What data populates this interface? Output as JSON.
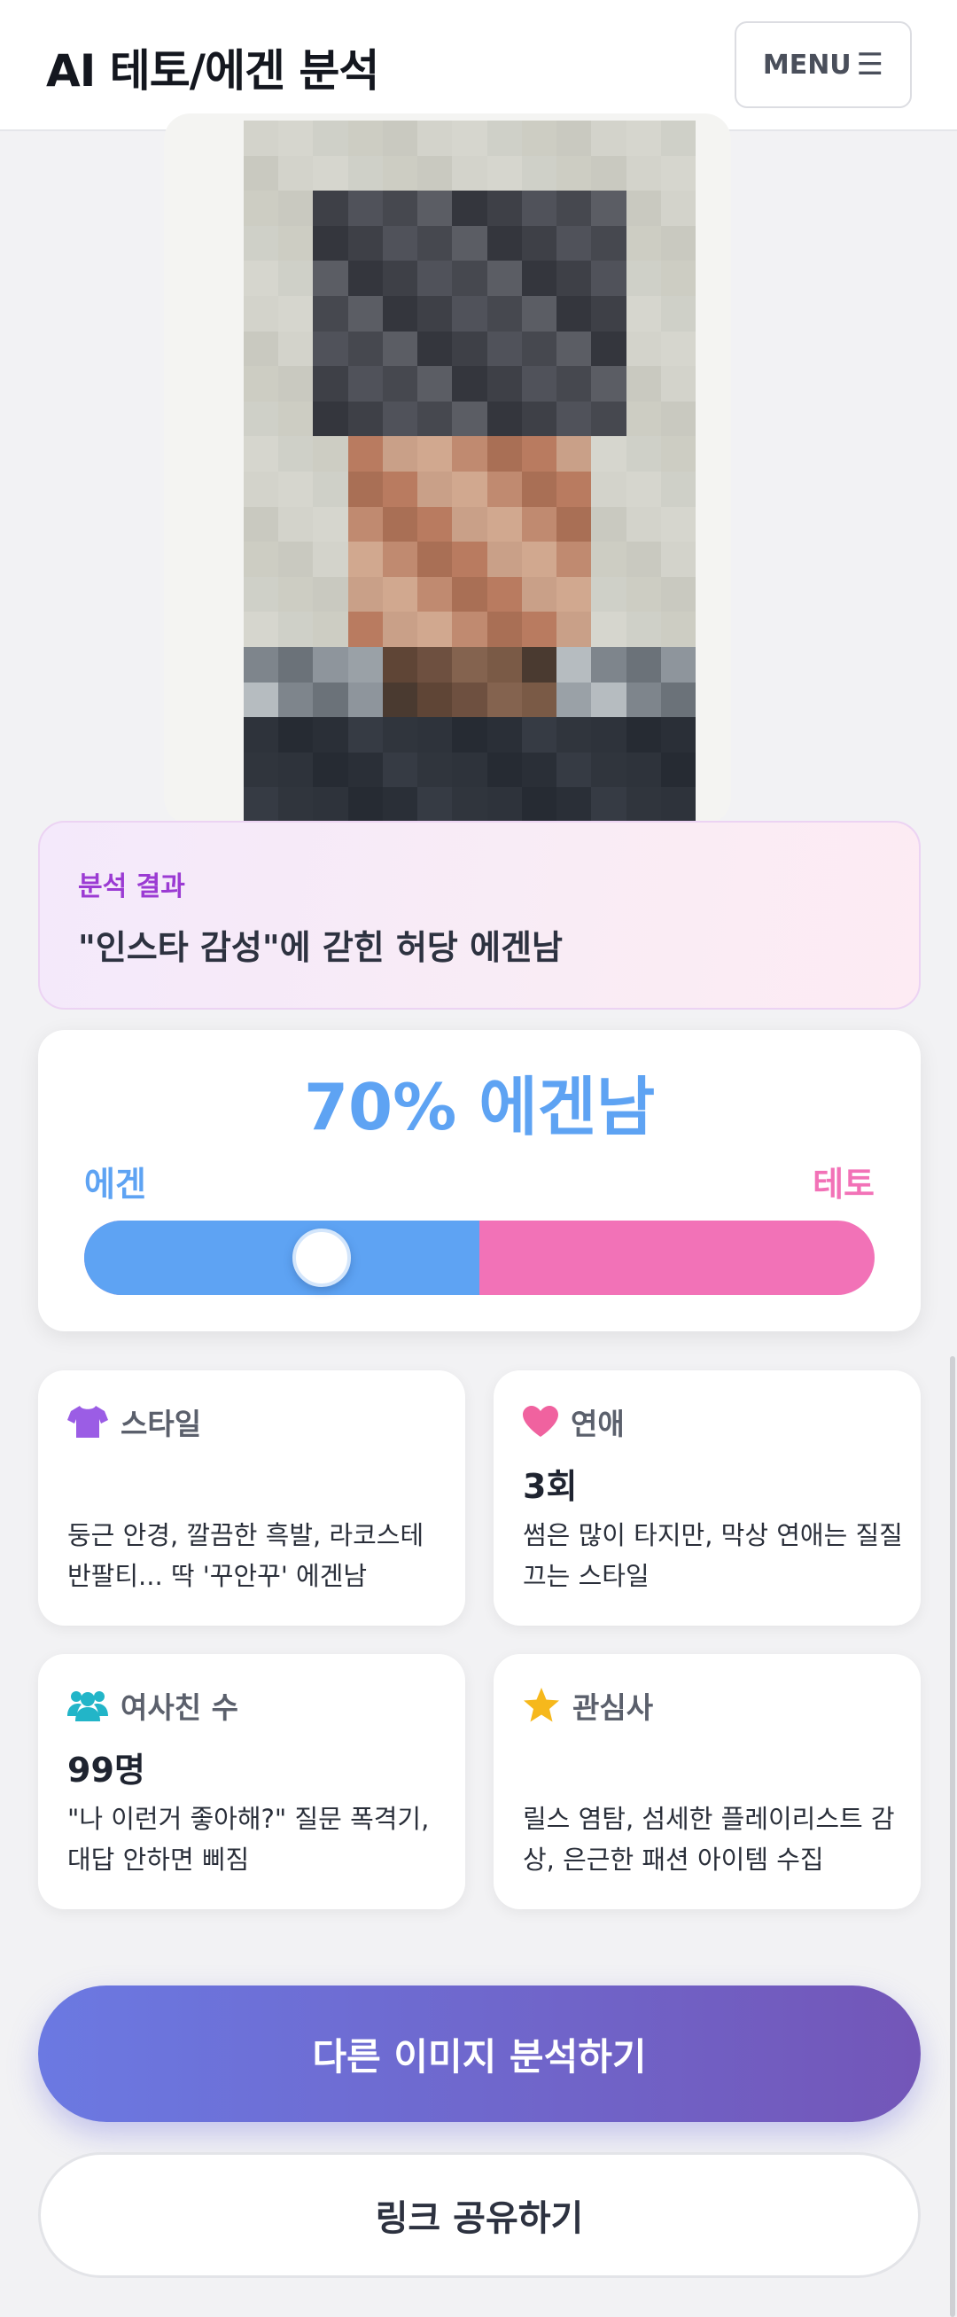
{
  "header": {
    "title": "AI 테토/에겐 분석",
    "menu_label": "MENU",
    "menu_icon": "hamburger-icon"
  },
  "photo": {
    "description_icon": "blurred-portrait-photo"
  },
  "result": {
    "label": "분석 결과",
    "title": "\"인스타 감성\"에 갇힌 허당 에겐남"
  },
  "score": {
    "headline": "70% 에겐남",
    "left_label": "에겐",
    "right_label": "테토",
    "slider_level": 0.3,
    "colors": {
      "egen": "#5ea3f3",
      "teto": "#f272b7"
    }
  },
  "cards": {
    "style": {
      "icon": "tshirt-icon",
      "label": "스타일",
      "value": "",
      "desc": "둥근 안경, 깔끔한 흑발, 라코스테 반팔티... 딱 '꾸안꾸' 에겐남"
    },
    "romance": {
      "icon": "heart-icon",
      "label": "연애",
      "value": "3회",
      "desc": "썸은 많이 타지만, 막상 연애는 질질 끄는 스타일"
    },
    "friends": {
      "icon": "people-icon",
      "label": "여사친 수",
      "value": "99명",
      "desc": "\"나 이런거 좋아해?\" 질문 폭격기, 대답 안하면 삐짐"
    },
    "interests": {
      "icon": "star-icon",
      "label": "관심사",
      "value": "",
      "desc": "릴스 염탐, 섬세한 플레이리스트 감상, 은근한 패션 아이템 수집"
    }
  },
  "actions": {
    "analyze_again": "다른 이미지 분석하기",
    "share_link": "링크 공유하기"
  }
}
